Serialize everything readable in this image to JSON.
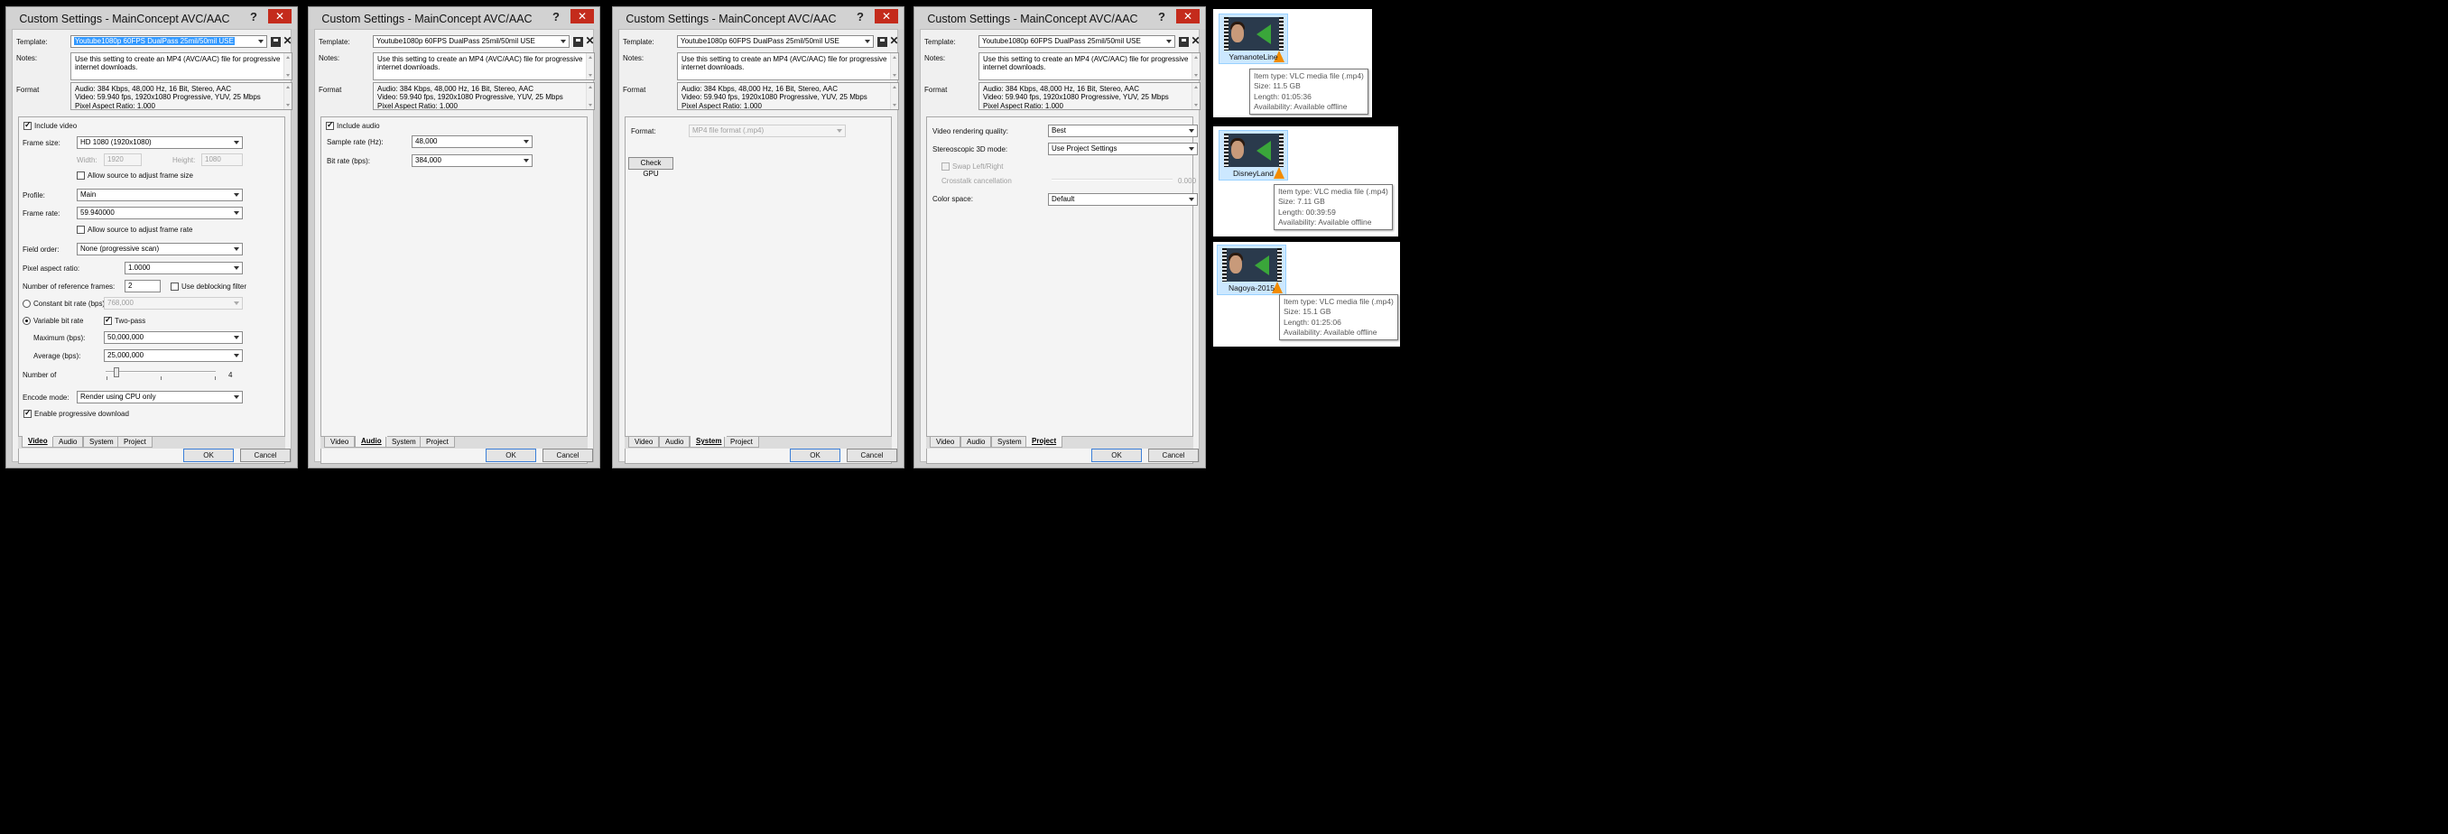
{
  "dialog": {
    "title": "Custom Settings - MainConcept AVC/AAC",
    "help": "?",
    "close": "✕",
    "template_label": "Template:",
    "template_value": "Youtube1080p 60FPS DualPass 25mil/50mil USE",
    "notes_label": "Notes:",
    "notes_text": "Use this setting to create an MP4 (AVC/AAC) file for progressive internet downloads.",
    "format_label": "Format",
    "format_lines": [
      "Audio: 384 Kbps, 48,000 Hz, 16 Bit, Stereo, AAC",
      "Video: 59.940 fps, 1920x1080 Progressive, YUV, 25 Mbps",
      "Pixel Aspect Ratio: 1.000"
    ],
    "tabs": [
      "Video",
      "Audio",
      "System",
      "Project"
    ],
    "ok": "OK",
    "cancel": "Cancel"
  },
  "video": {
    "include_video": "Include video",
    "frame_size_label": "Frame size:",
    "frame_size": "HD 1080 (1920x1080)",
    "width_label": "Width:",
    "width": "1920",
    "height_label": "Height:",
    "height": "1080",
    "allow_frame_size": "Allow source to adjust frame size",
    "profile_label": "Profile:",
    "profile": "Main",
    "frame_rate_label": "Frame rate:",
    "frame_rate": "59.940000",
    "allow_frame_rate": "Allow source to adjust frame rate",
    "field_order_label": "Field order:",
    "field_order": "None (progressive scan)",
    "par_label": "Pixel aspect ratio:",
    "par": "1.0000",
    "ref_frames_label": "Number of reference frames:",
    "ref_frames": "2",
    "deblocking": "Use deblocking filter",
    "cbr_label": "Constant bit rate (bps):",
    "cbr": "768,000",
    "vbr_label": "Variable bit rate",
    "two_pass": "Two-pass",
    "max_label": "Maximum (bps):",
    "max": "50,000,000",
    "avg_label": "Average (bps):",
    "avg": "25,000,000",
    "number_of_label": "Number of",
    "slider_value": "4",
    "slider_level": 0.1,
    "encode_mode_label": "Encode mode:",
    "encode_mode": "Render using CPU only",
    "progressive_download": "Enable progressive download"
  },
  "audio": {
    "include_audio": "Include audio",
    "sample_rate_label": "Sample rate (Hz):",
    "sample_rate": "48,000",
    "bit_rate_label": "Bit rate (bps):",
    "bit_rate": "384,000"
  },
  "system": {
    "format_label": "Format:",
    "format": "MP4 file format (.mp4)",
    "check_gpu": "Check GPU"
  },
  "project": {
    "quality_label": "Video rendering quality:",
    "quality": "Best",
    "stereo_label": "Stereoscopic 3D mode:",
    "stereo": "Use Project Settings",
    "swap": "Swap Left/Right",
    "crosstalk_label": "Crosstalk cancellation",
    "crosstalk_value": "0.000",
    "color_space_label": "Color space:",
    "color_space": "Default"
  },
  "files": [
    {
      "name": "YamanoteLine",
      "type": "Item type: VLC media file (.mp4)",
      "size": "Size: 11.5 GB",
      "length": "Length: 01:05:36",
      "availability": "Availability: Available offline"
    },
    {
      "name": "DisneyLand",
      "type": "Item type: VLC media file (.mp4)",
      "size": "Size: 7.11 GB",
      "length": "Length: 00:39:59",
      "availability": "Availability: Available offline"
    },
    {
      "name": "Nagoya-2015",
      "type": "Item type: VLC media file (.mp4)",
      "size": "Size: 15.1 GB",
      "length": "Length: 01:25:06",
      "availability": "Availability: Available offline"
    }
  ],
  "colors": {
    "close_red": "#c42b1c",
    "selection_blue": "#3399ff",
    "default_button_border": "#3c7fd8",
    "thumb_selection": "#cce8ff"
  }
}
